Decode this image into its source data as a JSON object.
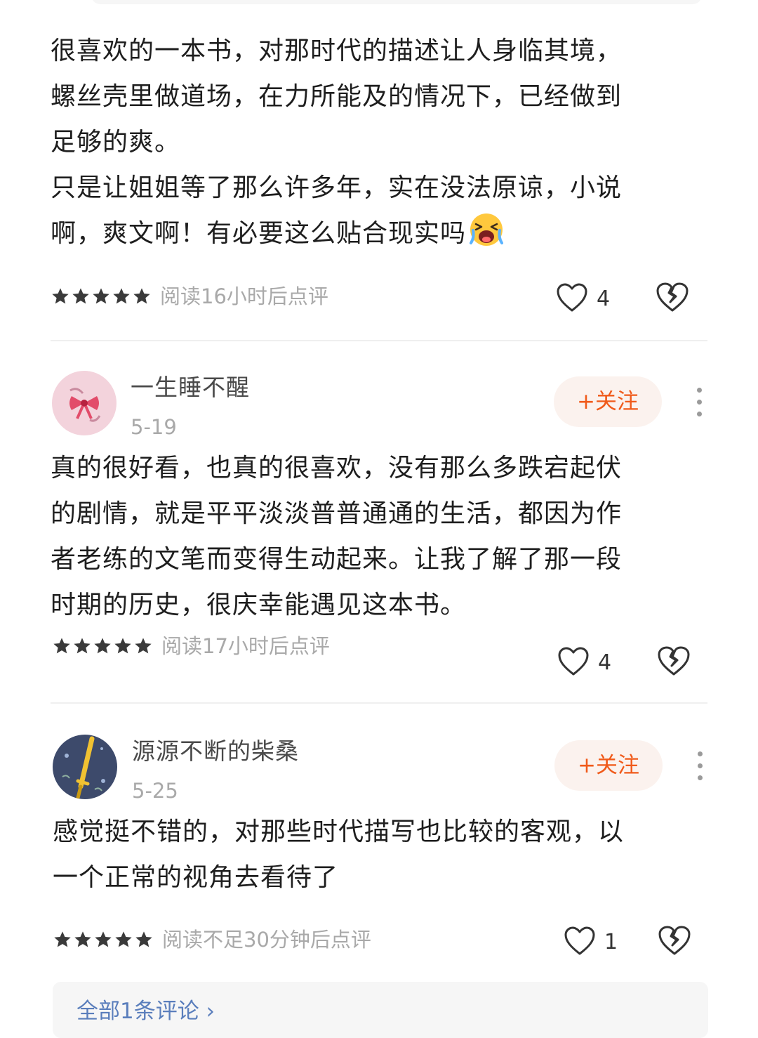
{
  "reviews": [
    {
      "text": "很喜欢的一本书，对那时代的描述让人身临其境，\n螺丝壳里做道场，在力所能及的情况下，已经做到\n足够的爽。\n只是让姐姐等了那么许多年，实在没法原谅，小说\n啊，爽文啊！有必要这么贴合现实吗",
      "emoji": "crying-face-emoji",
      "rating": 5,
      "read_time": "阅读16小时后点评",
      "likes": "4"
    },
    {
      "username": "一生睡不醒",
      "date": "5-19",
      "follow_label": "+关注",
      "avatar": "pink-bow-avatar",
      "text": "真的很好看，也真的很喜欢，没有那么多跌宕起伏\n的剧情，就是平平淡淡普普通通的生活，都因为作\n者老练的文笔而变得生动起来。让我了解了那一段\n时期的历史，很庆幸能遇见这本书。",
      "rating": 5,
      "read_time": "阅读17小时后点评",
      "likes": "4"
    },
    {
      "username": "源源不断的柴桑",
      "date": "5-25",
      "follow_label": "+关注",
      "avatar": "sword-night-avatar",
      "text": "感觉挺不错的，对那些时代描写也比较的客观，以\n一个正常的视角去看待了",
      "rating": 5,
      "read_time": "阅读不足30分钟后点评",
      "likes": "1"
    }
  ],
  "footer": {
    "all_reviews_label": "全部1条评论 ›"
  },
  "colors": {
    "accent": "#f05a1a",
    "follow_bg": "#fbf2ee",
    "meta_gray": "#a9a9a9",
    "star": "#3a3a3a"
  }
}
